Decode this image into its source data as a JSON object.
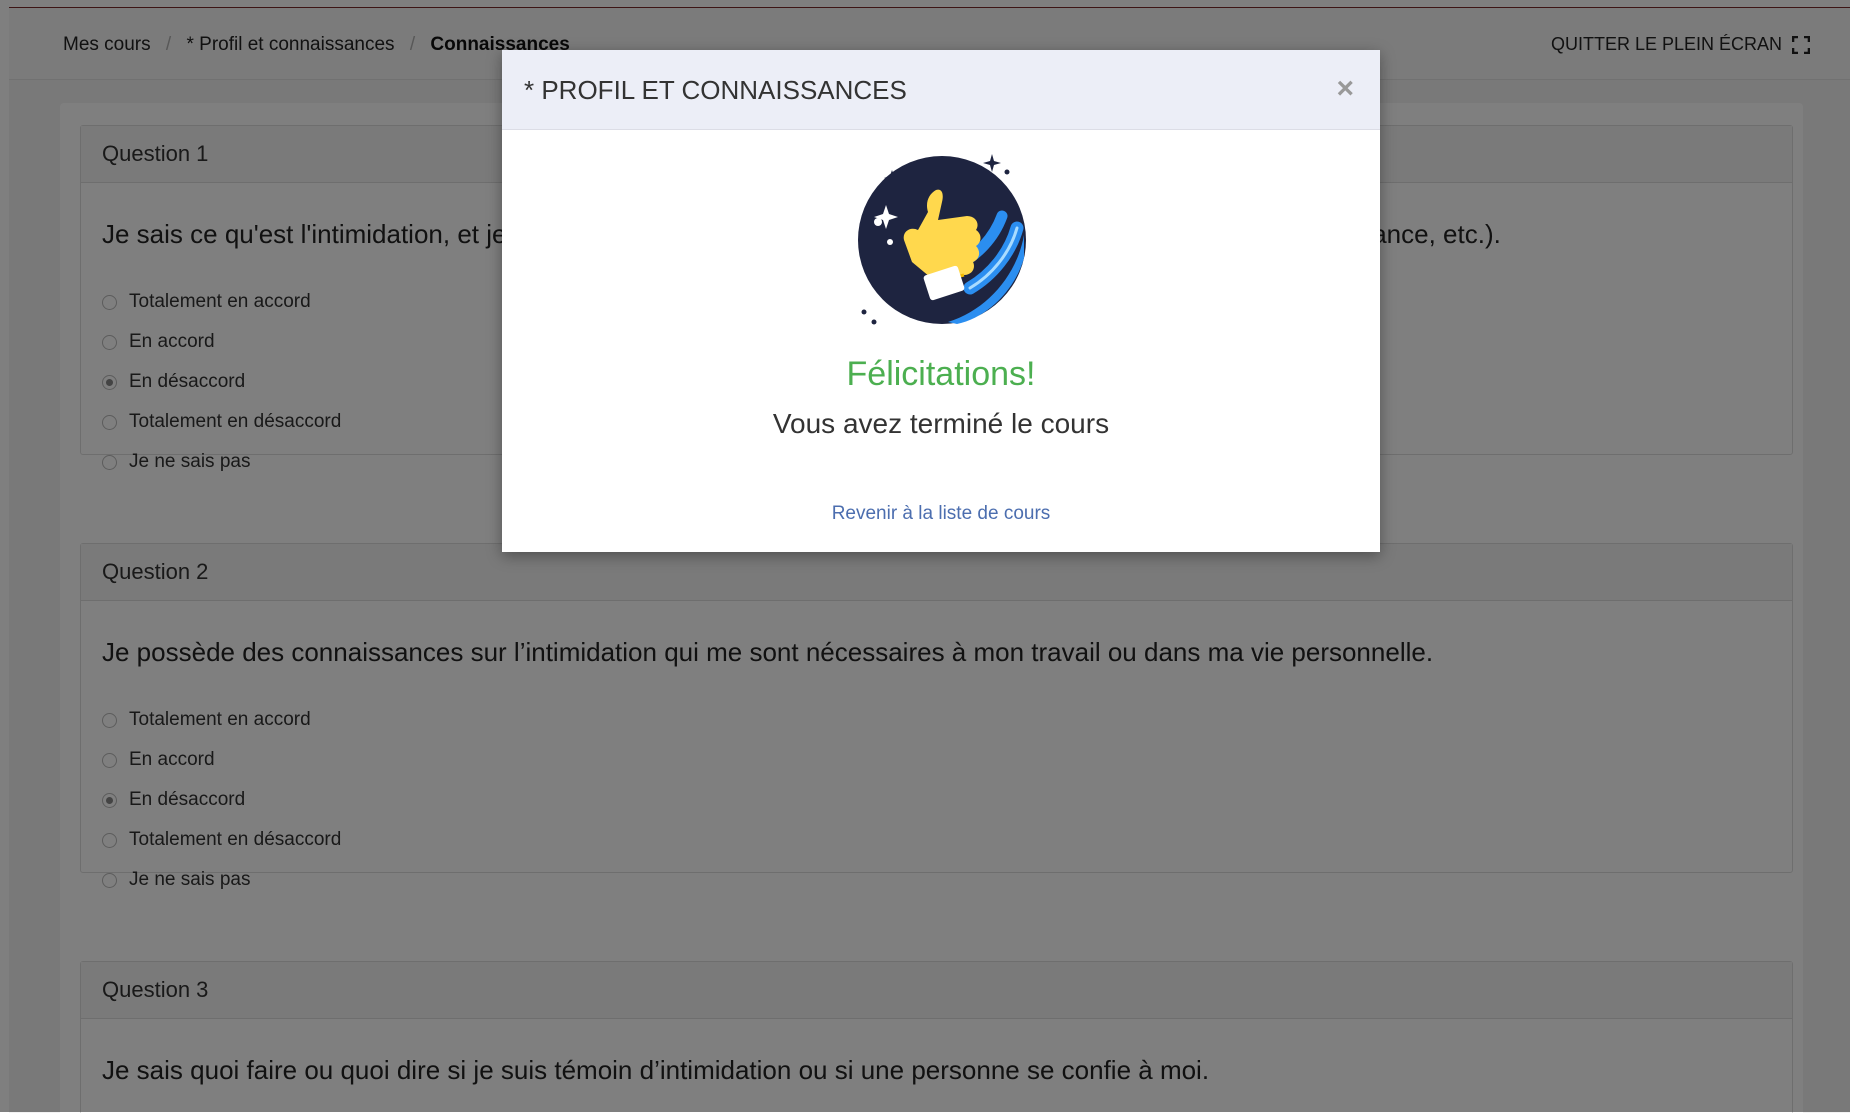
{
  "breadcrumb": {
    "items": [
      "Mes cours",
      "* Profil et connaissances",
      "Connaissances"
    ],
    "separator": "/"
  },
  "header": {
    "exit_fullscreen_label": "QUITTER LE PLEIN ÉCRAN"
  },
  "questions": [
    {
      "header": "Question 1",
      "text": "Je sais ce qu'est l'intimidation, et je peux la différencier d'autres comportements (conflits, harcèlement, maltraitance, etc.).",
      "options": [
        "Totalement en accord",
        "En accord",
        "En désaccord",
        "Totalement en désaccord",
        "Je ne sais pas"
      ],
      "selected": 2
    },
    {
      "header": "Question 2",
      "text": "Je possède des connaissances sur l’intimidation qui me sont nécessaires à mon travail ou dans ma vie personnelle.",
      "options": [
        "Totalement en accord",
        "En accord",
        "En désaccord",
        "Totalement en désaccord",
        "Je ne sais pas"
      ],
      "selected": 2
    },
    {
      "header": "Question 3",
      "text": "Je sais quoi faire ou quoi dire si je suis témoin d’intimidation ou si une personne se confie à moi."
    }
  ],
  "modal": {
    "title": "* PROFIL ET CONNAISSANCES",
    "close_symbol": "×",
    "illustration": "thumbs-up-icon",
    "congrats": "Félicitations!",
    "subtitle": "Vous avez terminé le cours",
    "link": "Revenir à la liste de cours"
  },
  "colors": {
    "accent_green": "#4caf50",
    "link_blue": "#4c6eaf",
    "modal_header_bg": "#eceef7",
    "illustration_navy": "#1e2440",
    "illustration_blue": "#2b8ef0",
    "illustration_yellow": "#ffd84d"
  }
}
